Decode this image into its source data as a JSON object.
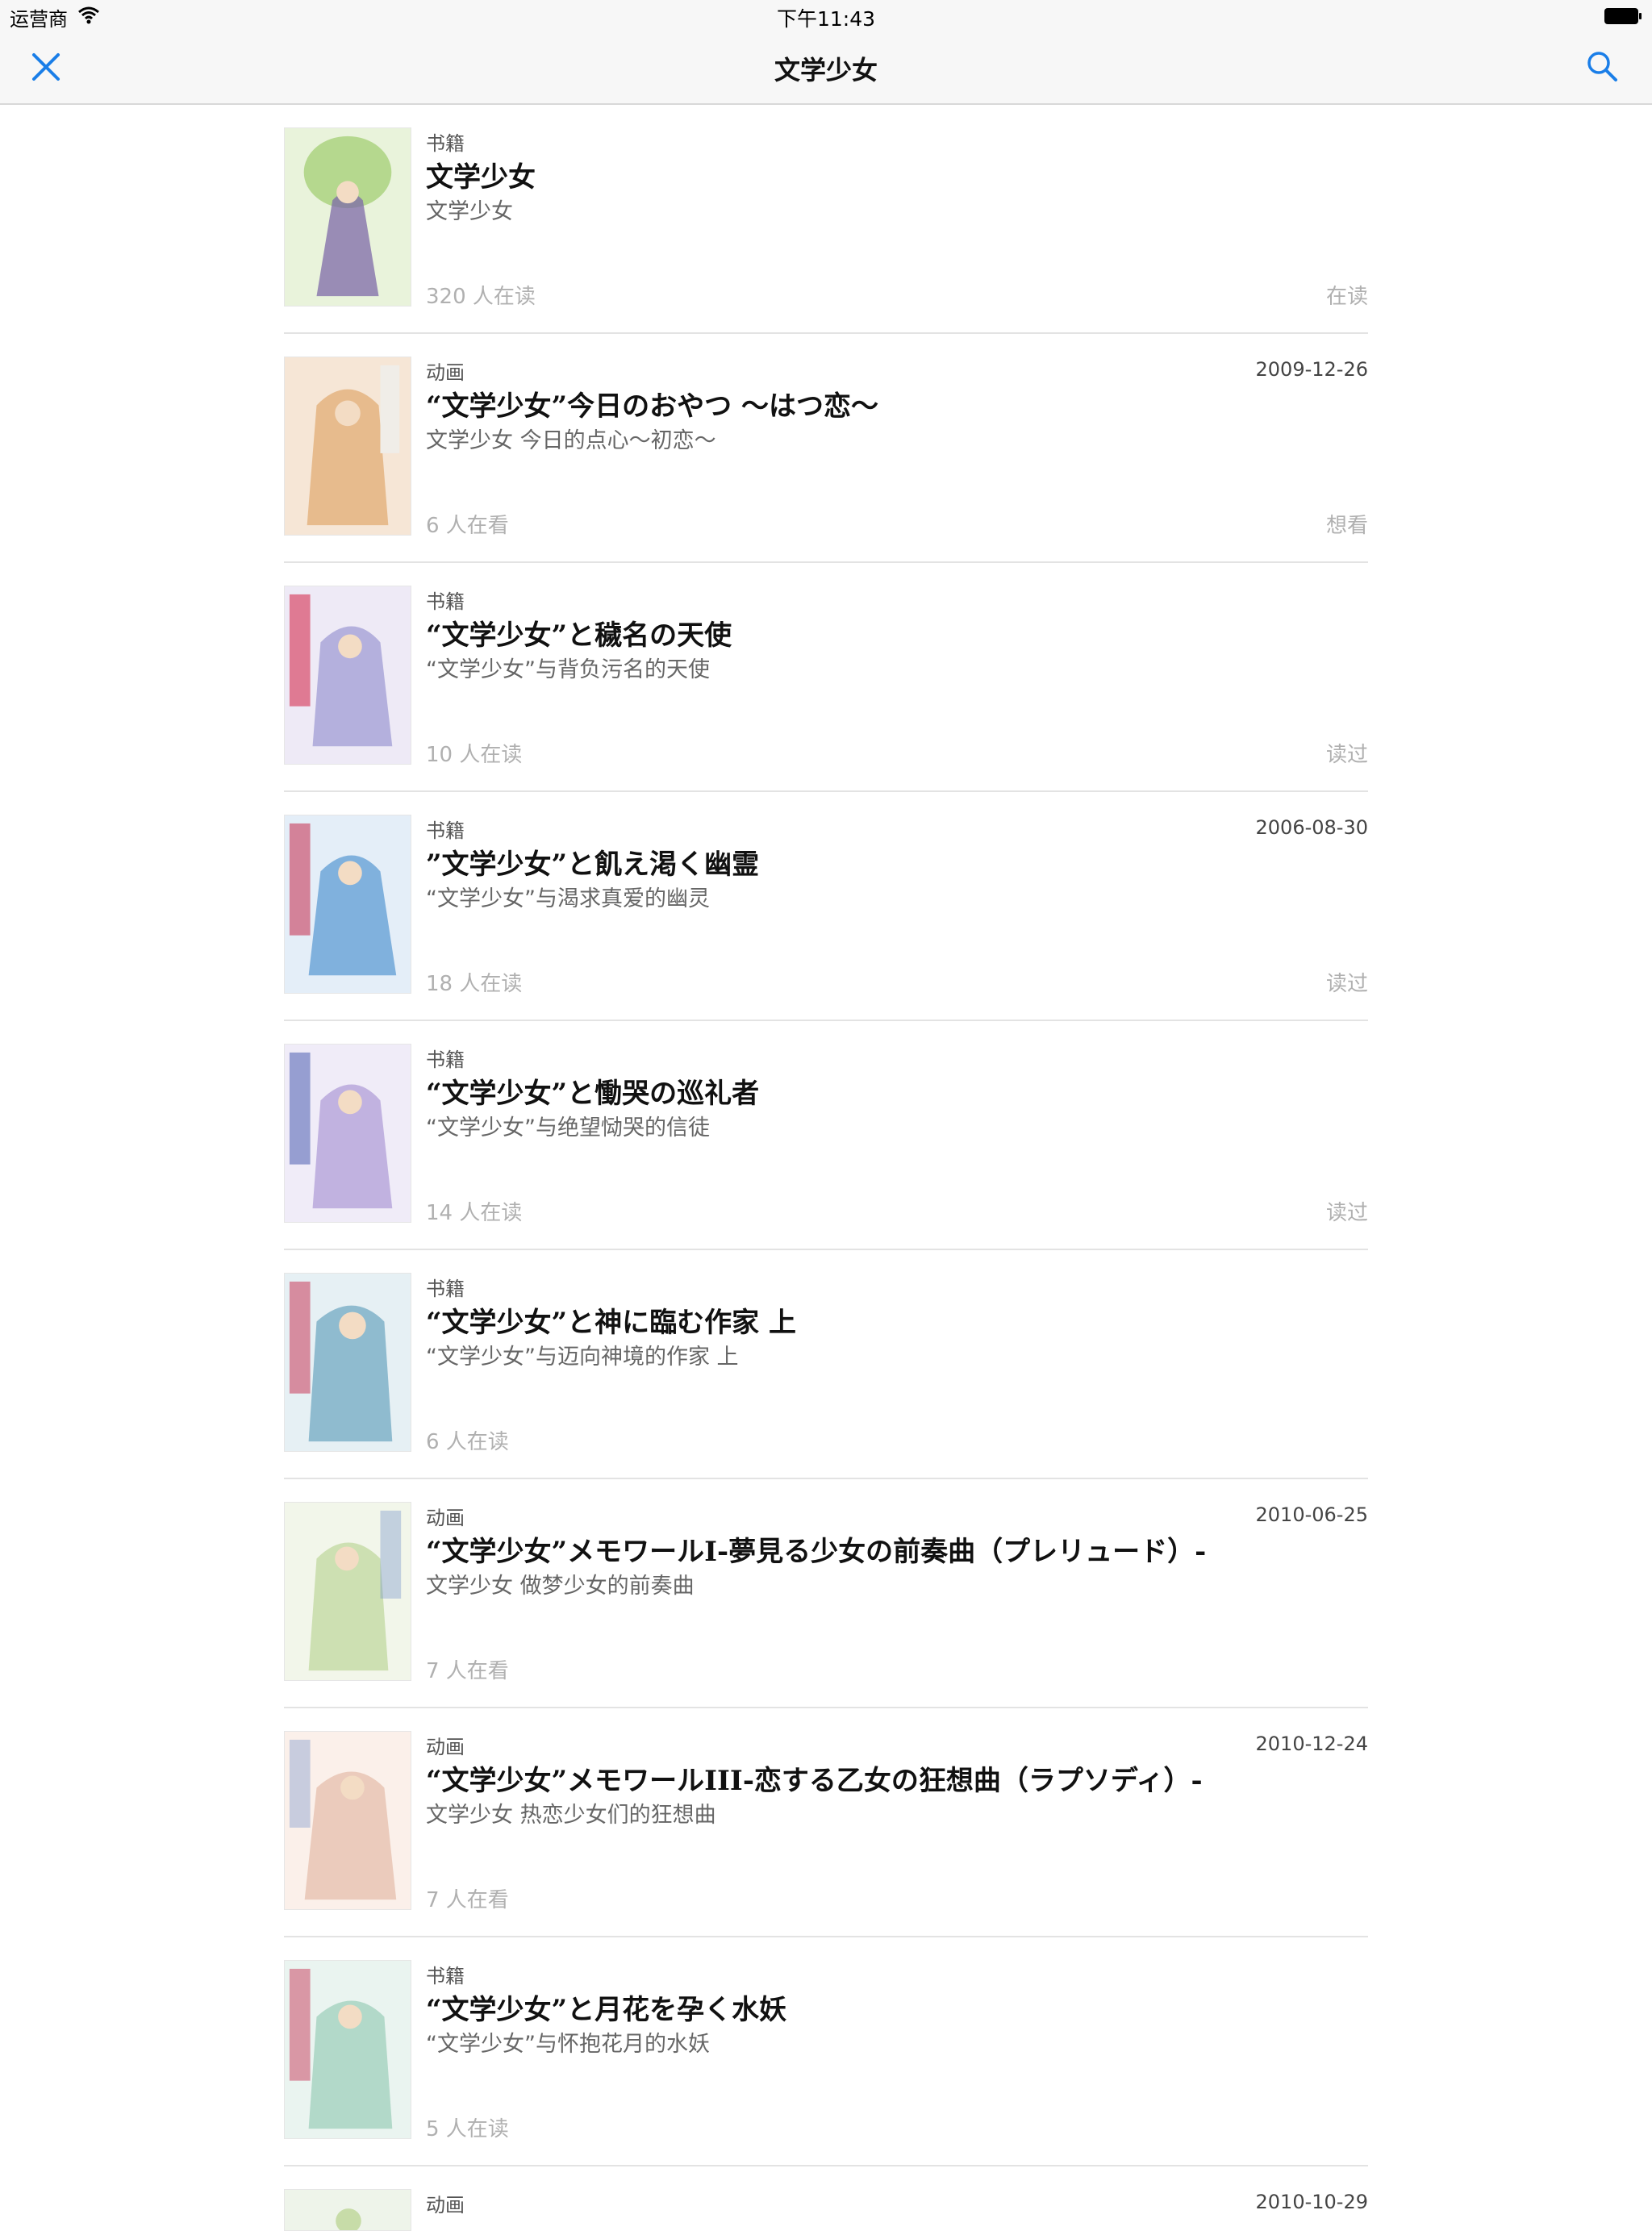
{
  "statusbar": {
    "carrier": "运营商",
    "time": "下午11:43"
  },
  "navbar": {
    "title": "文学少女",
    "close_icon": "close-icon",
    "search_icon": "search-icon"
  },
  "colors": {
    "accent": "#1a7ee8",
    "muted": "#b0b0b0"
  },
  "items": [
    {
      "type": "书籍",
      "date": "",
      "title": "文学少女",
      "subtitle": "文学少女",
      "readers": "320 人在读",
      "status": "在读",
      "cover_color": "#a8d17a"
    },
    {
      "type": "动画",
      "date": "2009-12-26",
      "title": "“文学少女”今日のおやつ ～はつ恋～",
      "subtitle": "文学少女 今日的点心～初恋～",
      "readers": "6 人在看",
      "status": "想看",
      "cover_color": "#e4b07a"
    },
    {
      "type": "书籍",
      "date": "",
      "title": "“文学少女”と穢名の天使",
      "subtitle": "“文学少女”与背负污名的天使",
      "readers": "10 人在读",
      "status": "读过",
      "cover_color": "#a9a6d8"
    },
    {
      "type": "书籍",
      "date": "2006-08-30",
      "title": "”文学少女”と飢え渇く幽霊",
      "subtitle": "“文学少女”与渴求真爱的幽灵",
      "readers": "18 人在读",
      "status": "读过",
      "cover_color": "#6fa6d8"
    },
    {
      "type": "书籍",
      "date": "",
      "title": "“文学少女”と慟哭の巡礼者",
      "subtitle": "“文学少女”与绝望恸哭的信徒",
      "readers": "14 人在读",
      "status": "读过",
      "cover_color": "#b8a8dc"
    },
    {
      "type": "书籍",
      "date": "",
      "title": "“文学少女”と神に臨む作家 上",
      "subtitle": "“文学少女”与迈向神境的作家 上",
      "readers": "6 人在读",
      "status": "",
      "cover_color": "#7fb1c8"
    },
    {
      "type": "动画",
      "date": "2010-06-25",
      "title": "“文学少女”メモワールI-夢見る少女の前奏曲（プレリュード）-",
      "subtitle": "文学少女 做梦少女的前奏曲",
      "readers": "7 人在看",
      "status": "",
      "cover_color": "#c7dca8"
    },
    {
      "type": "动画",
      "date": "2010-12-24",
      "title": "“文学少女”メモワールIII-恋する乙女の狂想曲（ラプソディ）-",
      "subtitle": "文学少女 热恋少女们的狂想曲",
      "readers": "7 人在看",
      "status": "",
      "cover_color": "#e8c4b4"
    },
    {
      "type": "书籍",
      "date": "",
      "title": "“文学少女”と月花を孕く水妖",
      "subtitle": "“文学少女”与怀抱花月的水妖",
      "readers": "5 人在读",
      "status": "",
      "cover_color": "#a8d4c2"
    }
  ],
  "partial_item": {
    "type": "动画",
    "date": "2010-10-29"
  }
}
